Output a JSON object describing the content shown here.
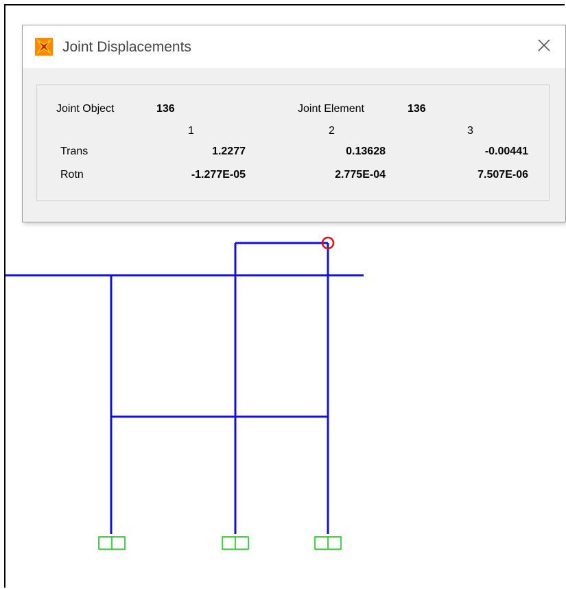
{
  "dialog": {
    "title": "Joint Displacements",
    "joint_object_label": "Joint  Object",
    "joint_object_value": "136",
    "joint_element_label": "Joint Element",
    "joint_element_value": "136",
    "columns": [
      "1",
      "2",
      "3"
    ],
    "rows": [
      {
        "label": "Trans",
        "values": [
          "1.2277",
          "0.13628",
          "-0.00441"
        ]
      },
      {
        "label": "Rotn",
        "values": [
          "-1.277E-05",
          "2.775E-04",
          "7.507E-06"
        ]
      }
    ]
  },
  "colors": {
    "frame_members": "#1010e0",
    "supports": "#00cc00",
    "selected_joint": "#e01010",
    "icon_accent": "#ff8800"
  }
}
